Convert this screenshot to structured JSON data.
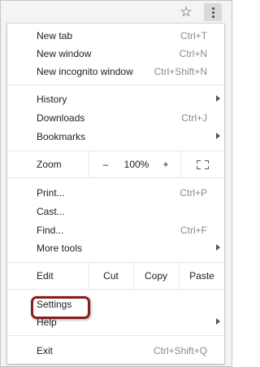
{
  "toolbar": {
    "star_icon": "star-outline-icon",
    "menu_icon": "more-vert-icon"
  },
  "menu": {
    "new_tab": {
      "label": "New tab",
      "shortcut": "Ctrl+T"
    },
    "new_window": {
      "label": "New window",
      "shortcut": "Ctrl+N"
    },
    "new_incognito": {
      "label": "New incognito window",
      "shortcut": "Ctrl+Shift+N"
    },
    "history": {
      "label": "History"
    },
    "downloads": {
      "label": "Downloads",
      "shortcut": "Ctrl+J"
    },
    "bookmarks": {
      "label": "Bookmarks"
    },
    "zoom": {
      "label": "Zoom",
      "minus": "–",
      "level": "100%",
      "plus": "+"
    },
    "print": {
      "label": "Print...",
      "shortcut": "Ctrl+P"
    },
    "cast": {
      "label": "Cast..."
    },
    "find": {
      "label": "Find...",
      "shortcut": "Ctrl+F"
    },
    "more_tools": {
      "label": "More tools"
    },
    "edit": {
      "label": "Edit",
      "cut": "Cut",
      "copy": "Copy",
      "paste": "Paste"
    },
    "settings": {
      "label": "Settings"
    },
    "help": {
      "label": "Help"
    },
    "exit": {
      "label": "Exit",
      "shortcut": "Ctrl+Shift+Q"
    }
  },
  "colors": {
    "highlight_border": "#8a1d1d",
    "shortcut_text": "#8a8a8a"
  }
}
